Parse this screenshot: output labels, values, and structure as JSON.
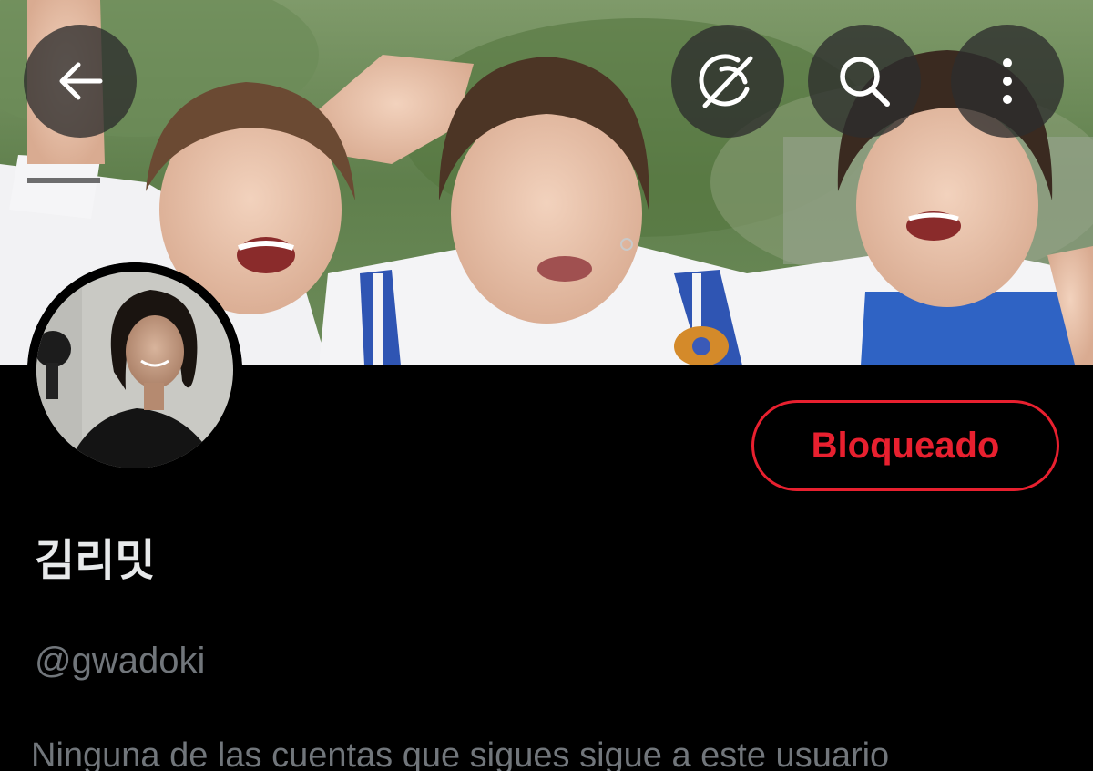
{
  "colors": {
    "background": "#000000",
    "primary_text": "#e7e9ea",
    "secondary_text": "#71767b",
    "blocked_red": "#e8202f",
    "overlay_button": "#2d2d2d"
  },
  "header": {
    "back_icon": "arrow-left-icon",
    "grok_icon": "grok-icon",
    "search_icon": "search-icon",
    "more_icon": "more-vertical-icon"
  },
  "banner": {
    "description_icon": "banner-photo"
  },
  "profile": {
    "display_name": "김리밋",
    "handle": "@gwadoki",
    "block_button_label": "Bloqueado",
    "followers_you_know": "Ninguna de las cuentas que sigues sigue a este usuario"
  }
}
